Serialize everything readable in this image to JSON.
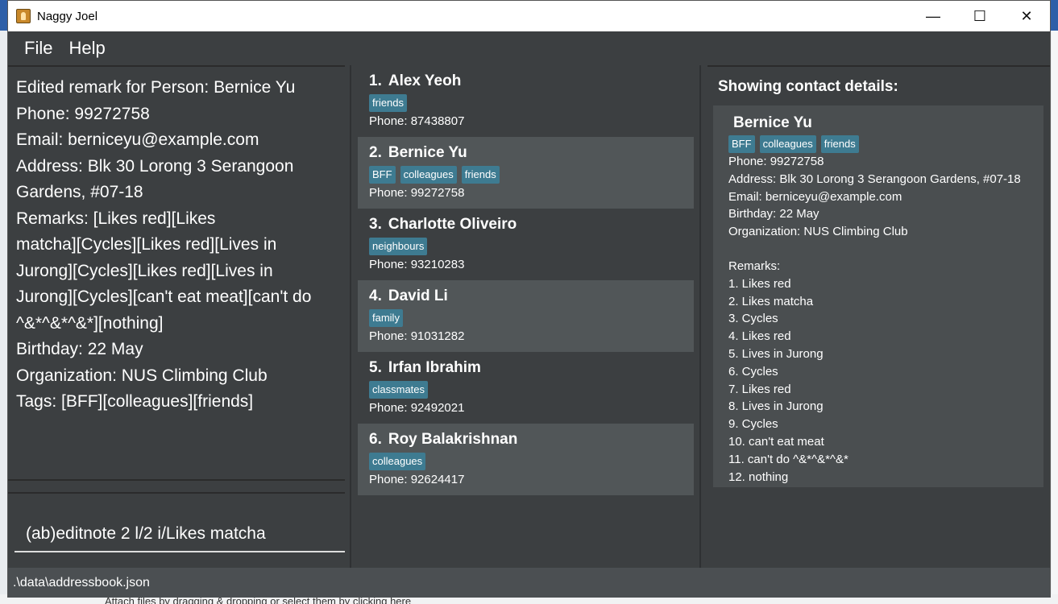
{
  "window": {
    "title": "Naggy Joel",
    "minimize": "—",
    "maximize": "☐",
    "close": "✕"
  },
  "menu": {
    "file": "File",
    "help": "Help"
  },
  "result_text": "Edited remark for Person: Bernice Yu\nPhone: 99272758\nEmail: berniceyu@example.com\nAddress: Blk 30 Lorong 3 Serangoon\nGardens, #07-18\nRemarks: [Likes red][Likes\nmatcha][Cycles][Likes red][Lives in\nJurong][Cycles][Likes red][Lives in\nJurong][Cycles][can't eat meat][can't do\n^&*^&*^&*][nothing]\nBirthday: 22 May\nOrganization: NUS Climbing Club\nTags: [BFF][colleagues][friends]",
  "command_input": "(ab)editnote 2 l/2 i/Likes matcha",
  "persons": [
    {
      "index": "1.",
      "name": "Alex Yeoh",
      "tags": [
        "friends"
      ],
      "phone": "Phone: 87438807"
    },
    {
      "index": "2.",
      "name": "Bernice Yu",
      "tags": [
        "BFF",
        "colleagues",
        "friends"
      ],
      "phone": "Phone: 99272758"
    },
    {
      "index": "3.",
      "name": "Charlotte Oliveiro",
      "tags": [
        "neighbours"
      ],
      "phone": "Phone: 93210283"
    },
    {
      "index": "4.",
      "name": "David Li",
      "tags": [
        "family"
      ],
      "phone": "Phone: 91031282"
    },
    {
      "index": "5.",
      "name": "Irfan Ibrahim",
      "tags": [
        "classmates"
      ],
      "phone": "Phone: 92492021"
    },
    {
      "index": "6.",
      "name": "Roy Balakrishnan",
      "tags": [
        "colleagues"
      ],
      "phone": "Phone: 92624417"
    }
  ],
  "details": {
    "header": "Showing contact details:",
    "name": "Bernice Yu",
    "tags": [
      "BFF",
      "colleagues",
      "friends"
    ],
    "phone": "Phone: 99272758",
    "address": "Address: Blk 30 Lorong 3 Serangoon Gardens, #07-18",
    "email": "Email: berniceyu@example.com",
    "birthday": "Birthday: 22 May",
    "organization": "Organization: NUS Climbing Club",
    "remarks_label": "Remarks:",
    "remarks": [
      "1. Likes red",
      "2. Likes matcha",
      "3. Cycles",
      "4. Likes red",
      "5. Lives in Jurong",
      "6. Cycles",
      "7. Likes red",
      "8. Lives in Jurong",
      "9. Cycles",
      "10. can't eat meat",
      "11. can't do ^&*^&*^&*",
      "12. nothing"
    ]
  },
  "status_bar": ".\\data\\addressbook.json",
  "background_text": "Attach files by dragging & dropping or select them by clicking here",
  "colors": {
    "tag": "#3e7b91",
    "panel": "#3c3f41",
    "card_alt": "#515658"
  }
}
